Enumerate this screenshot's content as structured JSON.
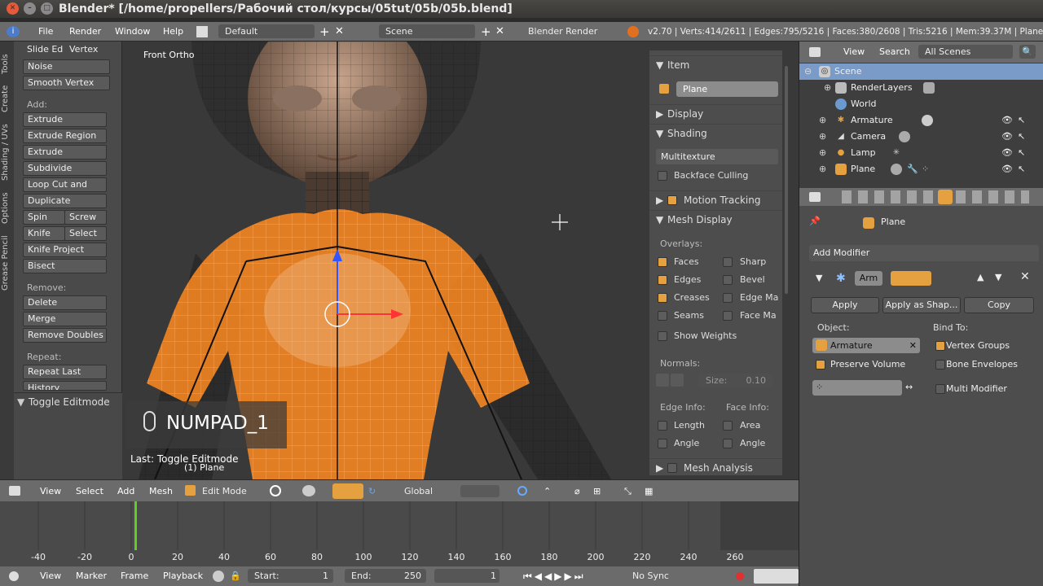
{
  "window": {
    "title": "Blender* [/home/propellers/Рабочий стол/курсы/05tut/05b/05b.blend]"
  },
  "menubar": {
    "items": [
      "File",
      "Render",
      "Window",
      "Help"
    ],
    "layout": "Default",
    "scene": "Scene",
    "engine": "Blender Render",
    "stats": "v2.70 | Verts:414/2611 | Edges:795/5216 | Faces:380/2608 | Tris:5216 | Mem:39.37M | Plane"
  },
  "toolshelf": {
    "tabs": [
      "Tools",
      "Create",
      "Shading / UVs",
      "Options",
      "Grease Pencil"
    ],
    "row1": [
      "Slide Ed",
      "Vertex"
    ],
    "noise": "Noise",
    "smooth": "Smooth Vertex",
    "add_label": "Add:",
    "extrude": "Extrude",
    "extrude_region": "Extrude Region",
    "extrude_individual": "Extrude Individual",
    "subdivide": "Subdivide",
    "loop_cut": "Loop Cut and Slide",
    "duplicate": "Duplicate",
    "spin": "Spin",
    "screw": "Screw",
    "knife": "Knife",
    "select": "Select",
    "knife_project": "Knife Project",
    "bisect": "Bisect",
    "remove_label": "Remove:",
    "delete": "Delete",
    "merge": "Merge",
    "remove_doubles": "Remove Doubles",
    "repeat_label": "Repeat:",
    "repeat_last": "Repeat Last",
    "history": "History",
    "operator": "Toggle Editmode"
  },
  "viewport": {
    "view_name": "Front Ortho",
    "key_hint": "NUMPAD_1",
    "last_op": "Last: Toggle Editmode",
    "object_name": "(1) Plane"
  },
  "npanel": {
    "item": "Item",
    "plane": "Plane",
    "display": "Display",
    "shading": "Shading",
    "multitexture": "Multitexture",
    "backface": "Backface Culling",
    "motion_tracking": "Motion Tracking",
    "mesh_display": "Mesh Display",
    "overlays": "Overlays:",
    "faces": "Faces",
    "sharp": "Sharp",
    "edges": "Edges",
    "bevel": "Bevel",
    "creases": "Creases",
    "edge_ma": "Edge Ma",
    "seams": "Seams",
    "face_ma": "Face Ma",
    "show_weights": "Show Weights",
    "normals": "Normals:",
    "size_label": "Size:",
    "size_val": "0.10",
    "edge_info": "Edge Info:",
    "face_info": "Face Info:",
    "length": "Length",
    "area": "Area",
    "angle1": "Angle",
    "angle2": "Angle",
    "mesh_analysis": "Mesh Analysis"
  },
  "vpheader": {
    "view": "View",
    "select": "Select",
    "add": "Add",
    "mesh": "Mesh",
    "mode": "Edit Mode",
    "orientation": "Global"
  },
  "timeline": {
    "ticks": [
      "-40",
      "-20",
      "0",
      "20",
      "40",
      "60",
      "80",
      "100",
      "120",
      "140",
      "160",
      "180",
      "200",
      "220",
      "240",
      "260"
    ],
    "current": 0
  },
  "tlheader": {
    "view": "View",
    "marker": "Marker",
    "frame": "Frame",
    "playback": "Playback",
    "start": "Start:",
    "start_val": "1",
    "end": "End:",
    "end_val": "250",
    "cur": "1",
    "sync": "No Sync"
  },
  "outliner": {
    "view": "View",
    "search": "Search",
    "filter": "All Scenes",
    "rows": [
      "Scene",
      "RenderLayers",
      "World",
      "Armature",
      "Camera",
      "Lamp",
      "Plane"
    ]
  },
  "props": {
    "object": "Plane",
    "add_modifier": "Add Modifier",
    "mod_name": "Arm",
    "apply": "Apply",
    "apply_shape": "Apply as Shap...",
    "copy": "Copy",
    "object_label": "Object:",
    "armature": "Armature",
    "bind_to": "Bind To:",
    "vertex_groups": "Vertex Groups",
    "preserve_volume": "Preserve Volume",
    "bone_envelopes": "Bone Envelopes",
    "multi_modifier": "Multi Modifier"
  },
  "colors": {
    "accent": "#e5a040",
    "selection": "#ff8a1e",
    "menubar": "#6b6b6b"
  }
}
